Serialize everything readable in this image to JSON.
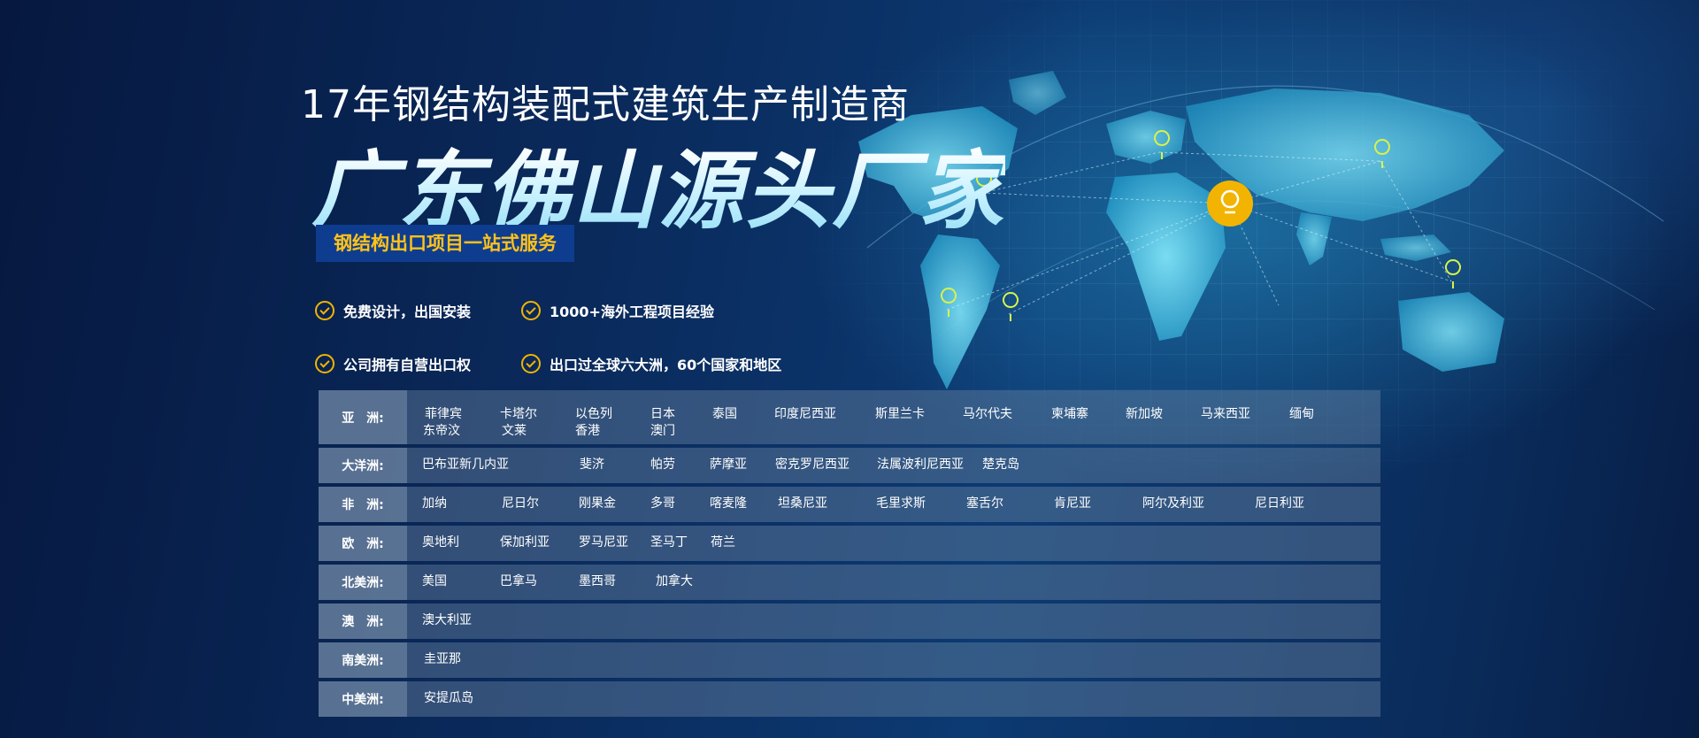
{
  "hero": {
    "subtitle": "17年钢结构装配式建筑生产制造商",
    "headline": "广东佛山源头厂家",
    "tagline": "钢结构出口项目一站式服务"
  },
  "features": [
    "免费设计，出国安装",
    "1000+海外工程项目经验",
    "公司拥有自营出口权",
    "出口过全球六大洲，60个国家和地区"
  ],
  "regions": [
    {
      "label": "亚　洲:",
      "countries": [
        "菲律宾",
        "卡塔尔",
        "以色列",
        "日本",
        "泰国",
        "印度尼西亚",
        "斯里兰卡",
        "马尔代夫",
        "柬埔寨",
        "新加坡",
        "马来西亚",
        "缅甸",
        "东帝汶",
        "文莱",
        "香港",
        "澳门"
      ]
    },
    {
      "label": "大洋洲:",
      "countries": [
        "巴布亚新几内亚",
        "斐济",
        "帕劳",
        "萨摩亚",
        "密克罗尼西亚",
        "法属波利尼西亚",
        "楚克岛"
      ]
    },
    {
      "label": "非　洲:",
      "countries": [
        "加纳",
        "尼日尔",
        "刚果金",
        "多哥",
        "喀麦隆",
        "坦桑尼亚",
        "毛里求斯",
        "塞舌尔",
        "肯尼亚",
        "阿尔及利亚",
        "尼日利亚"
      ]
    },
    {
      "label": "欧　洲:",
      "countries": [
        "奥地利",
        "保加利亚",
        "罗马尼亚",
        "圣马丁",
        "荷兰"
      ]
    },
    {
      "label": "北美洲:",
      "countries": [
        "美国",
        "巴拿马",
        "墨西哥",
        "加拿大"
      ]
    },
    {
      "label": "澳　洲:",
      "countries": [
        "澳大利亚"
      ]
    },
    {
      "label": "南美洲:",
      "countries": [
        "圭亚那"
      ]
    },
    {
      "label": "中美洲:",
      "countries": [
        "安提瓜岛"
      ]
    }
  ],
  "colors": {
    "accent": "#ffc21a",
    "check": "#f2b400",
    "tagline_bg": "#0e3d8f",
    "pin": "#f2b400",
    "map_land": "#46c8e6"
  },
  "icons": [
    "check-circle-icon",
    "location-pin-icon",
    "world-map"
  ]
}
